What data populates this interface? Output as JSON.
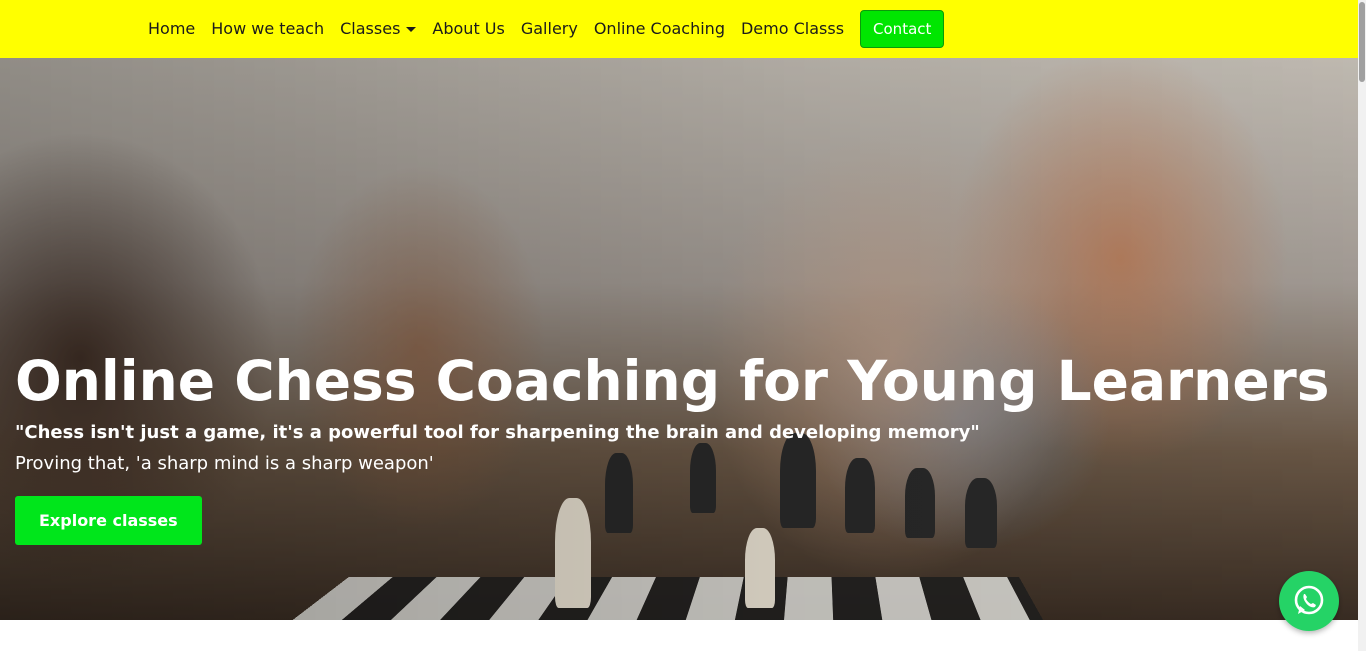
{
  "nav": {
    "items": [
      {
        "label": "Home"
      },
      {
        "label": "How we teach"
      },
      {
        "label": "Classes"
      },
      {
        "label": "About Us"
      },
      {
        "label": "Gallery"
      },
      {
        "label": "Online Coaching"
      },
      {
        "label": "Demo Classs"
      }
    ],
    "contact_label": "Contact"
  },
  "hero": {
    "title": "Online Chess Coaching for Young Learners",
    "quote": "\"Chess isn't just a game, it's a powerful tool for sharpening the brain and developing memory\"",
    "subtitle": "Proving that, 'a sharp mind is a sharp weapon'",
    "cta_label": "Explore classes"
  },
  "colors": {
    "navbar_bg": "#ffff00",
    "contact_bg": "#00e600",
    "cta_bg": "#00e61b",
    "whatsapp": "#25d366"
  },
  "icons": {
    "classes_dropdown": "chevron-down-icon",
    "whatsapp": "whatsapp-icon"
  }
}
